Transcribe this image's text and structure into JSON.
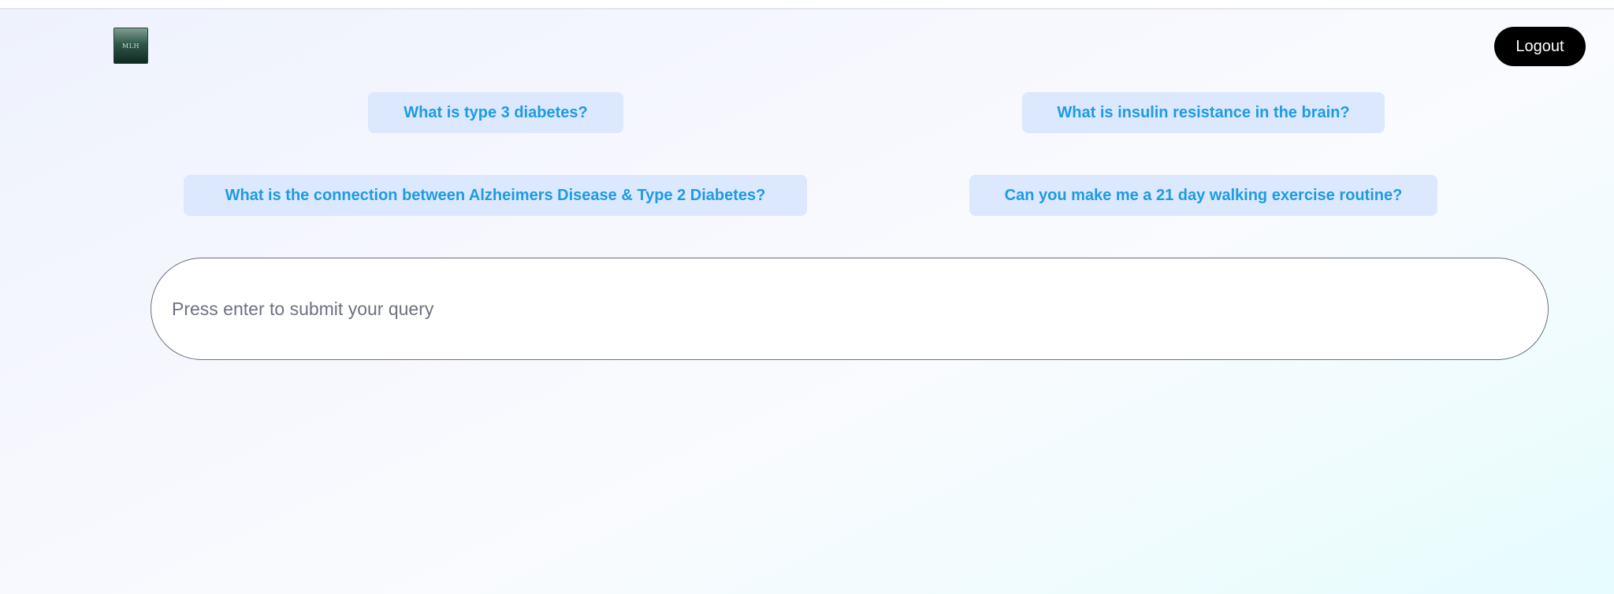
{
  "header": {
    "logo_text": "MLH",
    "logout_label": "Logout"
  },
  "suggestions": [
    {
      "label": "What is type 3 diabetes?"
    },
    {
      "label": "What is insulin resistance in the brain?"
    },
    {
      "label": "What is the connection between Alzheimers Disease & Type 2 Diabetes?"
    },
    {
      "label": "Can you make me a 21 day walking exercise routine?"
    }
  ],
  "query": {
    "value": "",
    "placeholder": "Press enter to submit your query"
  },
  "colors": {
    "chip_background": "#dbe8fd",
    "chip_text": "#1e9be3",
    "logout_background": "#000000"
  }
}
